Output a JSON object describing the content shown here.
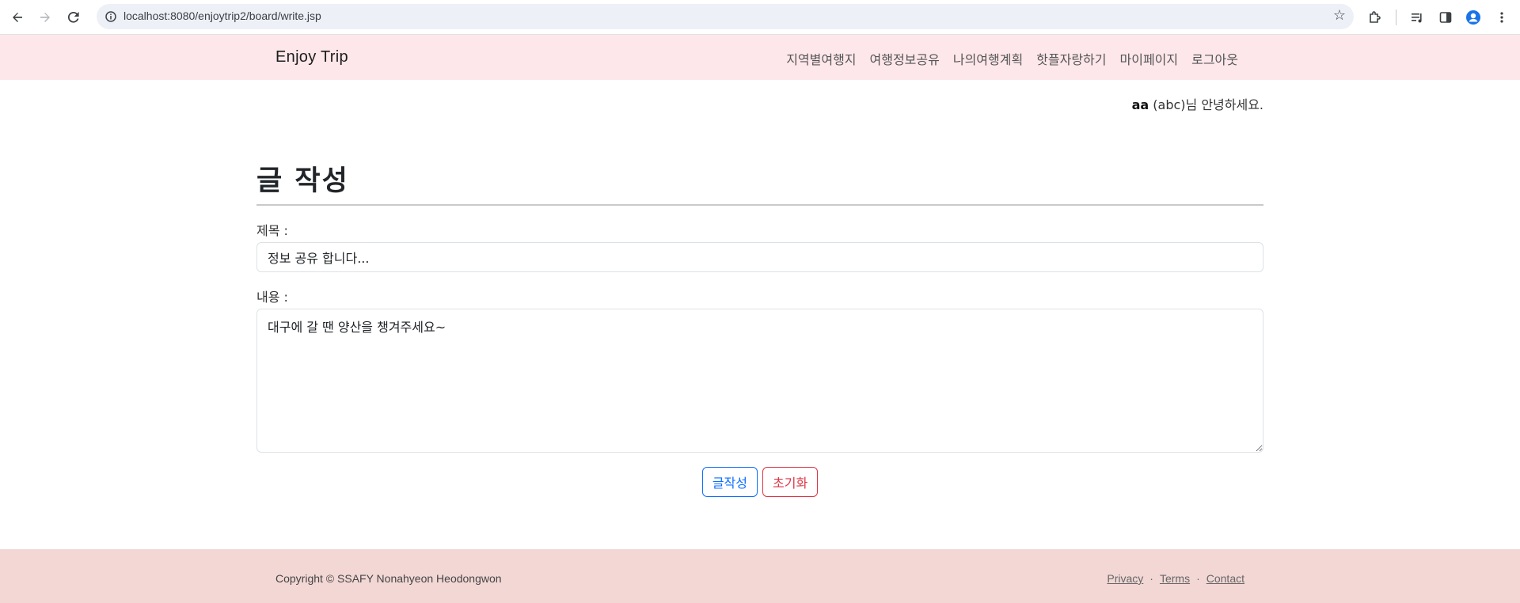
{
  "browser": {
    "url": "localhost:8080/enjoytrip2/board/write.jsp"
  },
  "header": {
    "brand": "Enjoy Trip",
    "menu": [
      "지역별여행지",
      "여행정보공유",
      "나의여행계획",
      "핫플자랑하기",
      "마이페이지",
      "로그아웃"
    ]
  },
  "greeting": {
    "user_id": "aa",
    "suffix": "(abc)님 안녕하세요."
  },
  "form": {
    "title": "글 작성",
    "subject_label": "제목 :",
    "subject_value": "정보 공유 합니다...",
    "content_label": "내용 :",
    "content_value": "대구에 갈 땐 양산을 챙겨주세요~",
    "submit_label": "글작성",
    "reset_label": "초기화"
  },
  "footer": {
    "copyright": "Copyright © SSAFY Nonahyeon Heodongwon",
    "links": [
      "Privacy",
      "Terms",
      "Contact"
    ],
    "separator": "·"
  },
  "colors": {
    "header_bg": "#fde7ea",
    "footer_bg": "#f2d7d5",
    "primary": "#0d6efd",
    "danger": "#dc3545"
  }
}
